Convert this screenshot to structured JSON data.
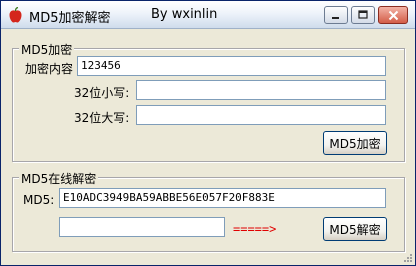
{
  "window": {
    "title": "MD5加密解密",
    "author": "By wxinlin"
  },
  "encrypt": {
    "group_title": "MD5加密",
    "content_label": "加密内容",
    "content_value": "123456",
    "lower_label": "32位小写:",
    "lower_value": "",
    "upper_label": "32位大写:",
    "upper_value": "",
    "button_label": "MD5加密"
  },
  "decrypt": {
    "group_title": "MD5在线解密",
    "md5_label": "MD5:",
    "md5_value": "E10ADC3949BA59ABBE56E057F20F883E",
    "result_value": "",
    "arrow_text": "=====>",
    "button_label": "MD5解密"
  }
}
